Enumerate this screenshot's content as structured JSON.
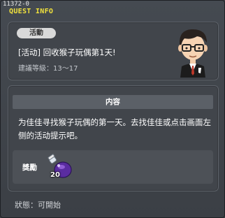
{
  "window": {
    "quest_id": "11372-0",
    "title": "QUEST INFO"
  },
  "quest": {
    "tag": "活動",
    "name": "[活动] 回收猴子玩偶第1天!",
    "level_req": "建議等級：13～17",
    "npc_icon": "npc-portrait-icon"
  },
  "content": {
    "header": "内容",
    "description": "为佳佳寻找猴子玩偶的第一天。去找佳佳或点击画面左侧的活动提示吧。"
  },
  "reward": {
    "label": "獎勵",
    "item_icon": "potion-icon",
    "quantity": "20"
  },
  "status": {
    "text": "狀態：可開始"
  }
}
